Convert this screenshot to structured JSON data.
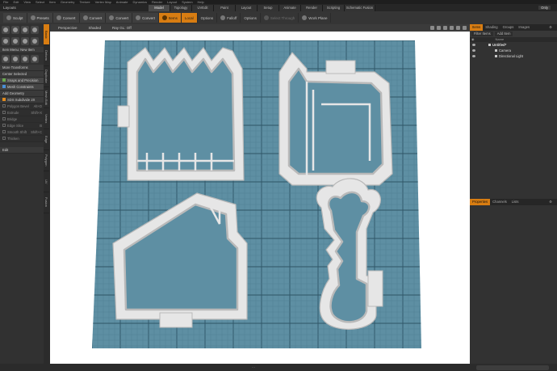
{
  "menubar": {
    "items": [
      "File",
      "Edit",
      "View",
      "Select",
      "Item",
      "Geometry",
      "Texture",
      "Vertex Map",
      "Animate",
      "Dynamics",
      "Render",
      "Layout",
      "System",
      "Help"
    ]
  },
  "title_row": {
    "layout_label": "Layouts",
    "mode_tabs": [
      "Model",
      "Topology",
      "UVEdit",
      "Paint",
      "Layout",
      "Setup",
      "Animate",
      "Render",
      "Scripting",
      "Schematic Fusion"
    ],
    "active_mode": "Model",
    "only_label": "Only"
  },
  "toolbar": {
    "sculpt": "Sculpt",
    "presets": "Presets",
    "convert_1": "Convert",
    "convert_2": "Convert",
    "convert_3": "Convert",
    "convert_4": "Convert",
    "items": "Items",
    "local": "Local",
    "options_1": "Options",
    "falloff": "Falloff",
    "options_2": "Options",
    "select_through": "Select Through",
    "work_plane": "Work Plane"
  },
  "left_panel": {
    "item_menu_label": "Item Menu: New Item",
    "more_transforms": "More Transforms",
    "center_selected": "Center Selected",
    "snaps": "Snaps and Precision",
    "mesh_constraints": "Mesh Constraints",
    "add_geometry": "Add Geometry",
    "sds_subdivide": "SDS Subdivide 2X",
    "polygon_bevel": "Polygon Bevel",
    "extrude": "Extrude",
    "bridge": "Bridge",
    "edge_slice": "Edge Slice",
    "smooth_shift": "Smooth Shift",
    "thicken": "Thicken",
    "edit_label": "Edit",
    "vertical_tabs": [
      "Basic",
      "Deform",
      "Duplicate",
      "Mesh Edit",
      "Vertex",
      "Edge",
      "Polygon",
      "UV",
      "Fusion"
    ],
    "active_vertical_tab": "Basic",
    "values": [
      "Alt+D",
      "Shift+X",
      "B",
      "Shift+C"
    ]
  },
  "viewport": {
    "perspective": "Perspective",
    "shaded": "Shaded",
    "gl_label": "Ray GL: Off"
  },
  "scene": {
    "background": "#ffffff",
    "plane_color": "#5e8fa3",
    "grid_minor": "#4f7c8f",
    "grid_major": "#2f5566",
    "cutter_fill": "#e6e6e6",
    "cutter_edge": "#b9b9b9"
  },
  "right_panel": {
    "tabs": [
      "Items",
      "Shading",
      "Groups",
      "Images"
    ],
    "active_tab": "Items",
    "filter_items": "Filter Items",
    "add_item": "Add Item",
    "col_name": "Name",
    "tree": [
      {
        "label": "Untitled*",
        "level": 0
      },
      {
        "label": "Camera",
        "level": 1
      },
      {
        "label": "Directional Light",
        "level": 1
      }
    ],
    "bottom_tabs": [
      "Properties",
      "Channels",
      "Lists"
    ],
    "active_bottom_tab": "Properties"
  },
  "colors": {
    "accent_orange": "#d87d12",
    "panel_bg": "#313131",
    "dark_bg": "#2a2a2a"
  }
}
